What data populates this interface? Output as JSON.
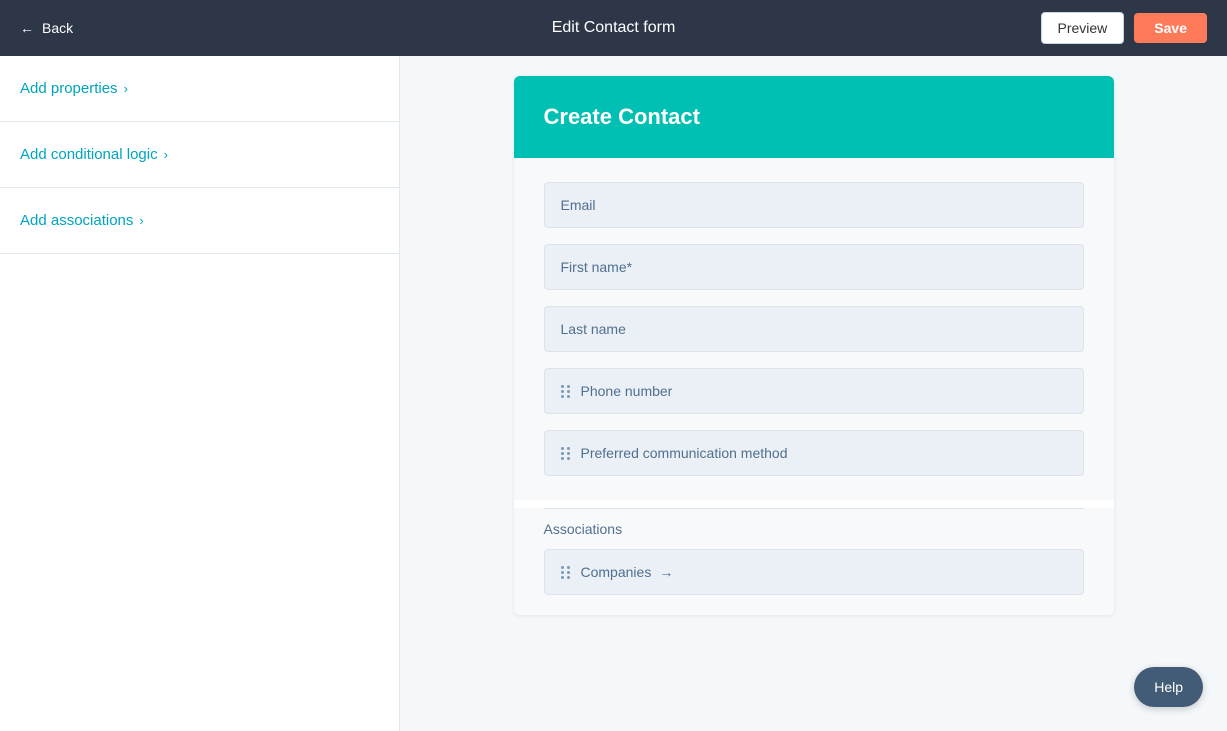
{
  "topbar": {
    "back_label": "Back",
    "title": "Edit Contact form",
    "preview_label": "Preview",
    "save_label": "Save"
  },
  "sidebar": {
    "items": [
      {
        "id": "add-properties",
        "label": "Add properties"
      },
      {
        "id": "add-conditional-logic",
        "label": "Add conditional logic"
      },
      {
        "id": "add-associations",
        "label": "Add associations"
      }
    ]
  },
  "form": {
    "header_title": "Create Contact",
    "fields": [
      {
        "id": "email",
        "label": "Email",
        "draggable": false
      },
      {
        "id": "first-name",
        "label": "First name*",
        "draggable": false
      },
      {
        "id": "last-name",
        "label": "Last name",
        "draggable": false
      },
      {
        "id": "phone-number",
        "label": "Phone number",
        "draggable": true
      },
      {
        "id": "preferred-communication",
        "label": "Preferred communication method",
        "draggable": true
      }
    ],
    "associations_label": "Associations",
    "companies_label": "Companies",
    "arrow": "→"
  },
  "help": {
    "label": "Help"
  }
}
